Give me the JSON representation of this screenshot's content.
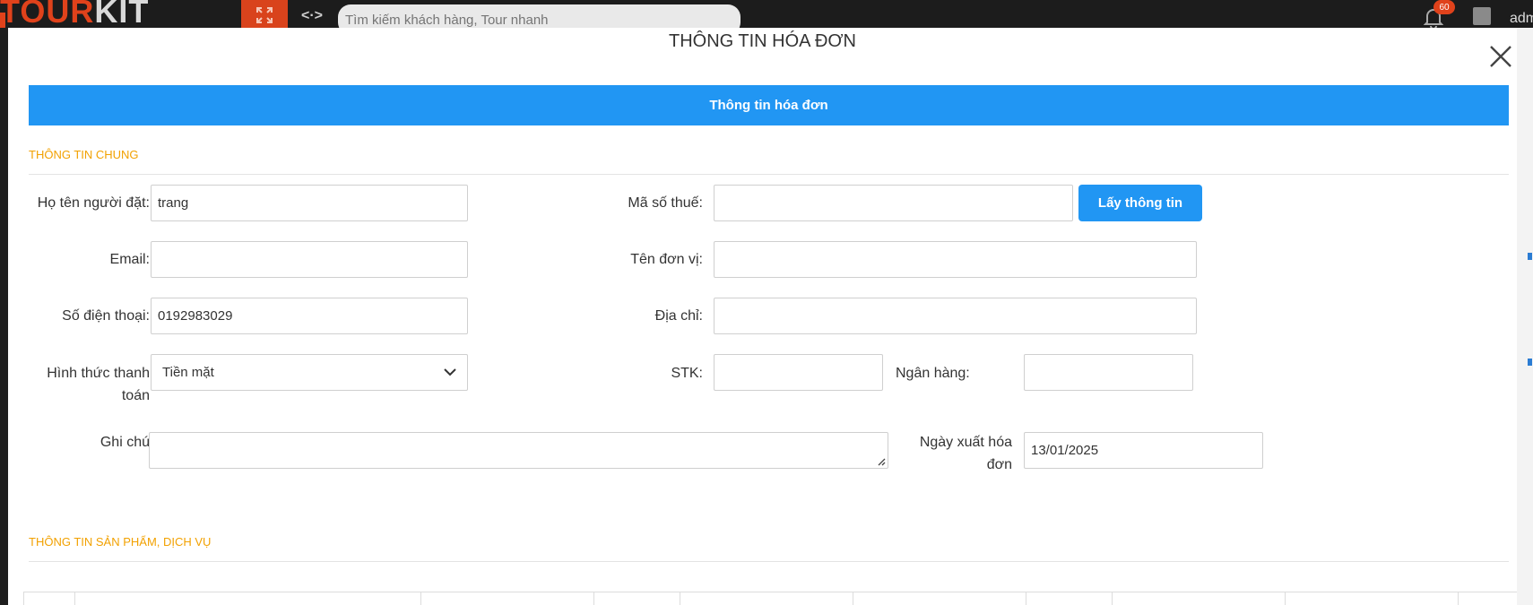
{
  "app": {
    "logo_tour": "TOUR",
    "logo_kit": "KIT",
    "search_placeholder": "Tìm kiếm khách hàng, Tour nhanh",
    "notification_count": "60",
    "user_label": "adm"
  },
  "modal": {
    "title": "THÔNG TIN HÓA ĐƠN",
    "tab_label": "Thông tin hóa đơn"
  },
  "general": {
    "section_title": "THÔNG TIN CHUNG",
    "booker_name_label": "Họ tên người đặt:",
    "booker_name_value": "trang",
    "email_label": "Email:",
    "email_value": "",
    "phone_label": "Số điện thoại:",
    "phone_value": "0192983029",
    "payment_method_label_line1": "Hình thức thanh",
    "payment_method_label_line2": "toán",
    "payment_method_value": "Tiền mặt",
    "note_label": "Ghi chú",
    "note_value": "",
    "tax_code_label": "Mã số thuế:",
    "tax_code_value": "",
    "fetch_button_label": "Lấy thông tin",
    "company_name_label": "Tên đơn vị:",
    "company_name_value": "",
    "address_label": "Địa chỉ:",
    "address_value": "",
    "account_number_label": "STK:",
    "account_number_value": "",
    "bank_label": "Ngân hàng:",
    "bank_value": "",
    "invoice_date_label_line1": "Ngày xuất hóa",
    "invoice_date_label_line2": "đơn",
    "invoice_date_value": "13/01/2025"
  },
  "products": {
    "section_title": "THÔNG TIN SẢN PHẨM, DỊCH VỤ"
  },
  "colors": {
    "accent_blue": "#2196f3",
    "section_orange": "#f2a100",
    "brand_red": "#e0421b"
  }
}
